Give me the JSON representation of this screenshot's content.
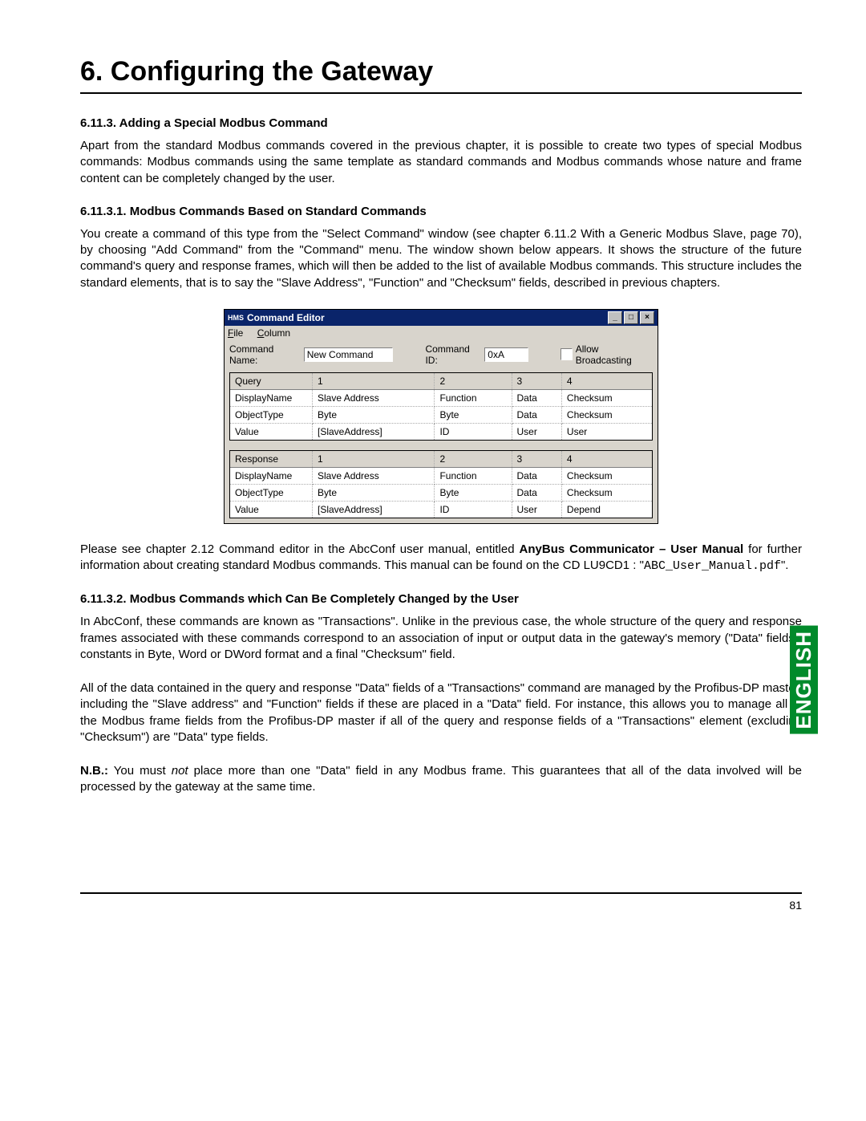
{
  "chapter_title": "6. Configuring the Gateway",
  "section_6_11_3": "6.11.3. Adding a Special Modbus Command",
  "para_6_11_3": "Apart from the standard Modbus commands covered in the previous chapter, it is possible to create two types of special Modbus commands: Modbus commands using the same template as standard commands and Modbus commands whose nature and frame content can be completely changed by the user.",
  "section_6_11_3_1": "6.11.3.1. Modbus Commands Based on Standard Commands",
  "para_6_11_3_1": "You create a command of this type from the \"Select Command\" window (see chapter 6.11.2 With a Generic Modbus Slave, page 70), by choosing \"Add Command\" from the \"Command\" menu. The window shown below appears. It shows the structure of the future command's query and response frames, which will then be added to the list of available Modbus commands. This structure includes the standard elements, that is to say the \"Slave Address\", \"Function\" and \"Checksum\" fields, described in previous chapters.",
  "para_after_fig_a": "Please see chapter 2.12 Command editor in the AbcConf user manual, entitled ",
  "para_after_fig_bold": "AnyBus Communicator – User Manual",
  "para_after_fig_b": " for further information about creating standard Modbus commands. This manual can be found on the CD LU9CD1 : \"",
  "para_after_fig_mono": "ABC_User_Manual.pdf",
  "para_after_fig_c": "\".",
  "section_6_11_3_2": "6.11.3.2. Modbus Commands which Can Be Completely Changed by the User",
  "para_6_11_3_2_a": "In AbcConf, these commands are known as \"Transactions\". Unlike in the previous case, the whole structure of the query and response frames associated with these commands correspond to an association of input or output data in the gateway's memory (\"Data\" fields), constants in Byte, Word or DWord format and a final \"Checksum\" field.",
  "para_6_11_3_2_b": "All of the data contained in the query and response \"Data\" fields of a \"Transactions\" command are managed by the Profibus-DP master, including the \"Slave address\" and \"Function\" fields if these are placed in a \"Data\" field. For instance, this allows you to manage all of the Modbus frame fields from the Profibus-DP master if all of the query and response fields of a \"Transactions\" element (excluding \"Checksum\") are \"Data\" type fields.",
  "nb_label": "N.B.:",
  "nb_text_a": " You must ",
  "nb_text_i": "not",
  "nb_text_b": " place more than one \"Data\" field in any Modbus frame. This guarantees that all of the data involved will be processed by the gateway at the same time.",
  "english_tab": "ENGLISH",
  "page_number": "81",
  "win": {
    "logo": "HMS",
    "title": "Command Editor",
    "menu_file": "File",
    "menu_column": "Column",
    "label_cmdname": "Command Name:",
    "value_cmdname": "New Command",
    "label_cmdid": "Command ID:",
    "value_cmdid": "0xA",
    "label_allow": "Allow Broadcasting",
    "query": {
      "h0": "Query",
      "h1": "1",
      "h2": "2",
      "h3": "3",
      "h4": "4",
      "r1c0": "DisplayName",
      "r1c1": "Slave Address",
      "r1c2": "Function",
      "r1c3": "Data",
      "r1c4": "Checksum",
      "r2c0": "ObjectType",
      "r2c1": "Byte",
      "r2c2": "Byte",
      "r2c3": "Data",
      "r2c4": "Checksum",
      "r3c0": "Value",
      "r3c1": "[SlaveAddress]",
      "r3c2": "ID",
      "r3c3": "User",
      "r3c4": "User"
    },
    "response": {
      "h0": "Response",
      "h1": "1",
      "h2": "2",
      "h3": "3",
      "h4": "4",
      "r1c0": "DisplayName",
      "r1c1": "Slave Address",
      "r1c2": "Function",
      "r1c3": "Data",
      "r1c4": "Checksum",
      "r2c0": "ObjectType",
      "r2c1": "Byte",
      "r2c2": "Byte",
      "r2c3": "Data",
      "r2c4": "Checksum",
      "r3c0": "Value",
      "r3c1": "[SlaveAddress]",
      "r3c2": "ID",
      "r3c3": "User",
      "r3c4": "Depend"
    }
  }
}
